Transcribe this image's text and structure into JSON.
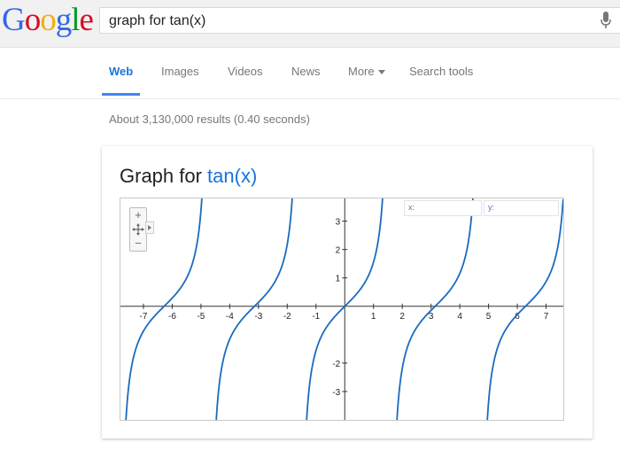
{
  "logo": {
    "letters": [
      {
        "char": "G",
        "color": "#3369e8"
      },
      {
        "char": "o",
        "color": "#d50f25"
      },
      {
        "char": "o",
        "color": "#eeb211"
      },
      {
        "char": "g",
        "color": "#3369e8"
      },
      {
        "char": "l",
        "color": "#009925"
      },
      {
        "char": "e",
        "color": "#d50f25"
      }
    ]
  },
  "search": {
    "query": "graph for tan(x)",
    "mic_icon": "microphone-icon"
  },
  "tabs": [
    {
      "label": "Web",
      "active": true
    },
    {
      "label": "Images"
    },
    {
      "label": "Videos"
    },
    {
      "label": "News"
    },
    {
      "label": "More"
    },
    {
      "label": "Search tools"
    }
  ],
  "stats": "About 3,130,000 results (0.40 seconds)",
  "card": {
    "title_prefix": "Graph for ",
    "title_function": "tan(x)"
  },
  "graph": {
    "x_readout_label": "x:",
    "y_readout_label": "y:",
    "controls": {
      "zoom_in": "+",
      "zoom_out": "−",
      "pan_icon": "move-icon"
    },
    "axis_color": "#333333",
    "curve_color": "#1a6bbf"
  },
  "chart_data": {
    "type": "line",
    "function": "tan(x)",
    "xlim": [
      -7.8,
      7.6
    ],
    "ylim": [
      -4,
      3.8
    ],
    "x_ticks": [
      -7,
      -6,
      -5,
      -4,
      -3,
      -2,
      -1,
      1,
      2,
      3,
      4,
      5,
      6,
      7
    ],
    "y_ticks": [
      -3,
      -2,
      1,
      2,
      3
    ],
    "grid": false
  }
}
